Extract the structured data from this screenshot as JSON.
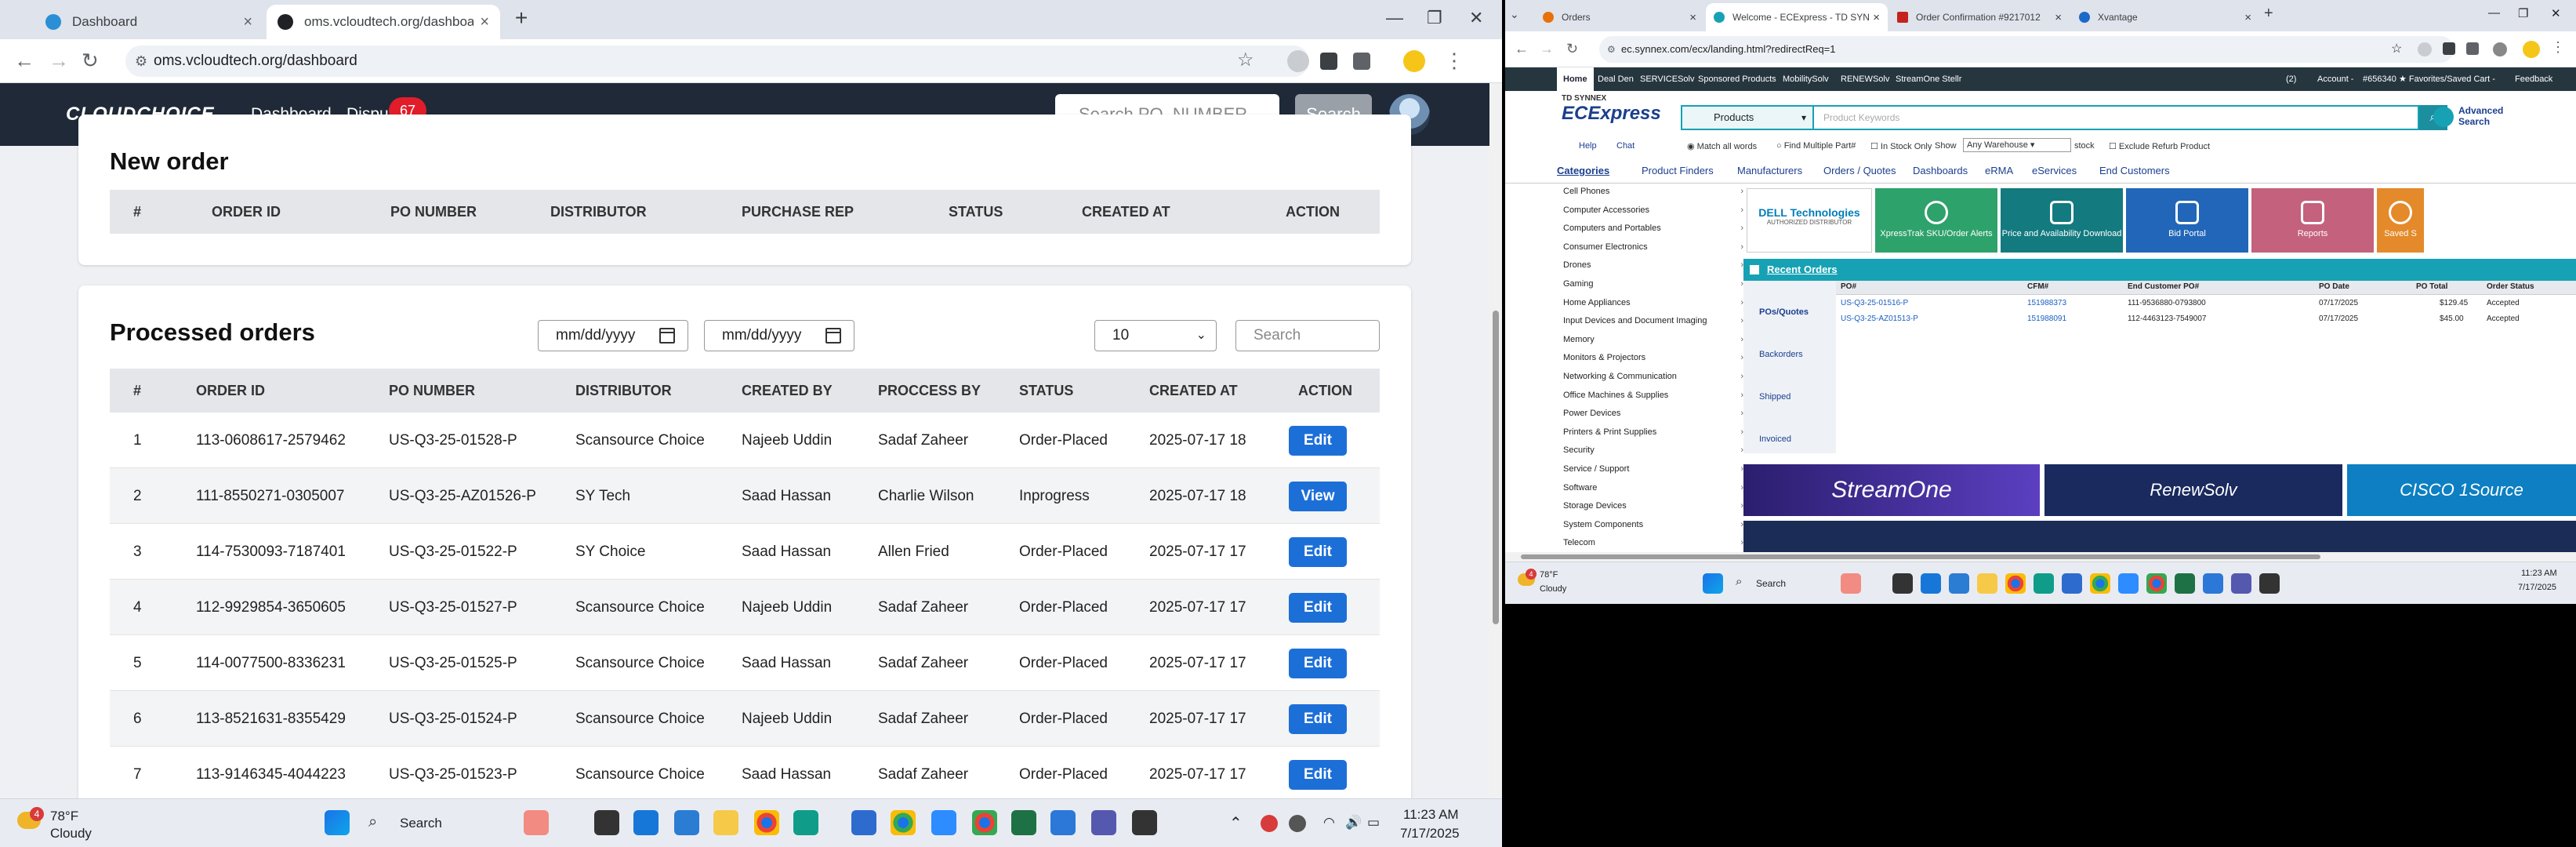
{
  "left": {
    "tabs": [
      {
        "label": "Dashboard",
        "active": false
      },
      {
        "label": "oms.vcloudtech.org/dashboard",
        "active": true
      }
    ],
    "url": "oms.vcloudtech.org/dashboard",
    "app": {
      "logo": "CLOUDCHOICE",
      "nav": [
        "Dashboard",
        "Dispu"
      ],
      "badge": "67",
      "search_placeholder": "Search PO_NUMBER...",
      "search_button": "Search"
    },
    "new_order": {
      "title": "New order",
      "headers": [
        "#",
        "ORDER ID",
        "PO NUMBER",
        "DISTRIBUTOR",
        "PURCHASE REP",
        "STATUS",
        "CREATED AT",
        "ACTION"
      ]
    },
    "processed": {
      "title": "Processed orders",
      "date_placeholder": "mm/dd/yyyy",
      "page_size": "10",
      "search_placeholder": "Search",
      "headers": [
        "#",
        "ORDER ID",
        "PO NUMBER",
        "DISTRIBUTOR",
        "CREATED BY",
        "PROCCESS BY",
        "STATUS",
        "CREATED AT",
        "ACTION"
      ],
      "rows": [
        {
          "n": "1",
          "order": "113-0608617-2579462",
          "po": "US-Q3-25-01528-P",
          "dist": "Scansource Choice",
          "by": "Najeeb Uddin",
          "proc": "Sadaf Zaheer",
          "status": "Order-Placed",
          "created": "2025-07-17 18",
          "action": "Edit"
        },
        {
          "n": "2",
          "order": "111-8550271-0305007",
          "po": "US-Q3-25-AZ01526-P",
          "dist": "SY Tech",
          "by": "Saad Hassan",
          "proc": "Charlie Wilson",
          "status": "Inprogress",
          "created": "2025-07-17 18",
          "action": "View"
        },
        {
          "n": "3",
          "order": "114-7530093-7187401",
          "po": "US-Q3-25-01522-P",
          "dist": "SY Choice",
          "by": "Saad Hassan",
          "proc": "Allen Fried",
          "status": "Order-Placed",
          "created": "2025-07-17 17",
          "action": "Edit"
        },
        {
          "n": "4",
          "order": "112-9929854-3650605",
          "po": "US-Q3-25-01527-P",
          "dist": "Scansource Choice",
          "by": "Najeeb Uddin",
          "proc": "Sadaf Zaheer",
          "status": "Order-Placed",
          "created": "2025-07-17 17",
          "action": "Edit"
        },
        {
          "n": "5",
          "order": "114-0077500-8336231",
          "po": "US-Q3-25-01525-P",
          "dist": "Scansource Choice",
          "by": "Saad Hassan",
          "proc": "Sadaf Zaheer",
          "status": "Order-Placed",
          "created": "2025-07-17 17",
          "action": "Edit"
        },
        {
          "n": "6",
          "order": "113-8521631-8355429",
          "po": "US-Q3-25-01524-P",
          "dist": "Scansource Choice",
          "by": "Najeeb Uddin",
          "proc": "Sadaf Zaheer",
          "status": "Order-Placed",
          "created": "2025-07-17 17",
          "action": "Edit"
        },
        {
          "n": "7",
          "order": "113-9146345-4044223",
          "po": "US-Q3-25-01523-P",
          "dist": "Scansource Choice",
          "by": "Saad Hassan",
          "proc": "Sadaf Zaheer",
          "status": "Order-Placed",
          "created": "2025-07-17 17",
          "action": "Edit"
        }
      ]
    },
    "taskbar": {
      "notif": "4",
      "temp": "78°F",
      "weather": "Cloudy",
      "search": "Search",
      "time": "11:23 AM",
      "date": "7/17/2025"
    }
  },
  "right": {
    "tabs": [
      {
        "label": "Orders",
        "active": false
      },
      {
        "label": "Welcome - ECExpress - TD SYN",
        "active": true
      },
      {
        "label": "Order Confirmation #9217012",
        "active": false
      },
      {
        "label": "Xvantage",
        "active": false
      }
    ],
    "url": "ec.synnex.com/ecx/landing.html?redirectReq=1",
    "topnav": [
      "Home",
      "Deal Den",
      "SERVICESolv",
      "Sponsored Products",
      "MobilitySolv",
      "RENEWSolv",
      "StreamOne Stellr"
    ],
    "topright": [
      "(2)",
      "Account -",
      "#656340",
      "★ Favorites/Saved Cart -",
      "Feedback"
    ],
    "brand_small": "TD SYNNEX",
    "brand": "ECExpress",
    "product_select": "Products",
    "keyword_placeholder": "Product Keywords",
    "advanced": [
      "Advanced",
      "Search"
    ],
    "help": "Help",
    "chat": "Chat",
    "options": [
      "Match all words",
      "Find Multiple Part#",
      "In Stock Only",
      "Show",
      "Any Warehouse",
      "stock",
      "Exclude Refurb Product"
    ],
    "menu": [
      "Categories",
      "Product Finders",
      "Manufacturers",
      "Orders / Quotes",
      "Dashboards",
      "eRMA",
      "eServices",
      "End Customers"
    ],
    "categories": [
      "Cell Phones",
      "Computer Accessories",
      "Computers and Portables",
      "Consumer Electronics",
      "Drones",
      "Gaming",
      "Home Appliances",
      "Input Devices and Document Imaging",
      "Memory",
      "Monitors & Projectors",
      "Networking & Communication",
      "Office Machines & Supplies",
      "Power Devices",
      "Printers & Print Supplies",
      "Security",
      "Service / Support",
      "Software",
      "Storage Devices",
      "System Components",
      "Telecom"
    ],
    "promos": [
      {
        "label": "DELL Technologies",
        "sub": "AUTHORIZED DISTRIBUTOR",
        "color": "#ffffff"
      },
      {
        "label": "XpressTrak SKU/Order Alerts",
        "color": "#2ea26b"
      },
      {
        "label": "Price and Availability Download",
        "color": "#137a7f"
      },
      {
        "label": "Bid Portal",
        "color": "#2166b8"
      },
      {
        "label": "Reports",
        "color": "#c4617c"
      },
      {
        "label": "Saved S",
        "color": "#e48a2a"
      }
    ],
    "recent_title": "Recent Orders",
    "ro_tabs": [
      "POs/Quotes",
      "Backorders",
      "Shipped",
      "Invoiced"
    ],
    "ro_headers": [
      "PO#",
      "CFM#",
      "End Customer PO#",
      "PO Date",
      "PO Total",
      "Order Status"
    ],
    "ro_rows": [
      [
        "US-Q3-25-01516-P",
        "151988373",
        "111-9536880-0793800",
        "07/17/2025",
        "$129.45",
        "Accepted"
      ],
      [
        "US-Q3-25-AZ01513-P",
        "151988091",
        "112-4463123-7549007",
        "07/17/2025",
        "$45.00",
        "Accepted"
      ]
    ],
    "banners": [
      "StreamOne",
      "RenewSolv",
      "CISCO 1Source"
    ],
    "taskbar": {
      "notif": "4",
      "temp": "78°F",
      "weather": "Cloudy",
      "search": "Search",
      "time": "11:23 AM",
      "date": "7/17/2025"
    }
  }
}
